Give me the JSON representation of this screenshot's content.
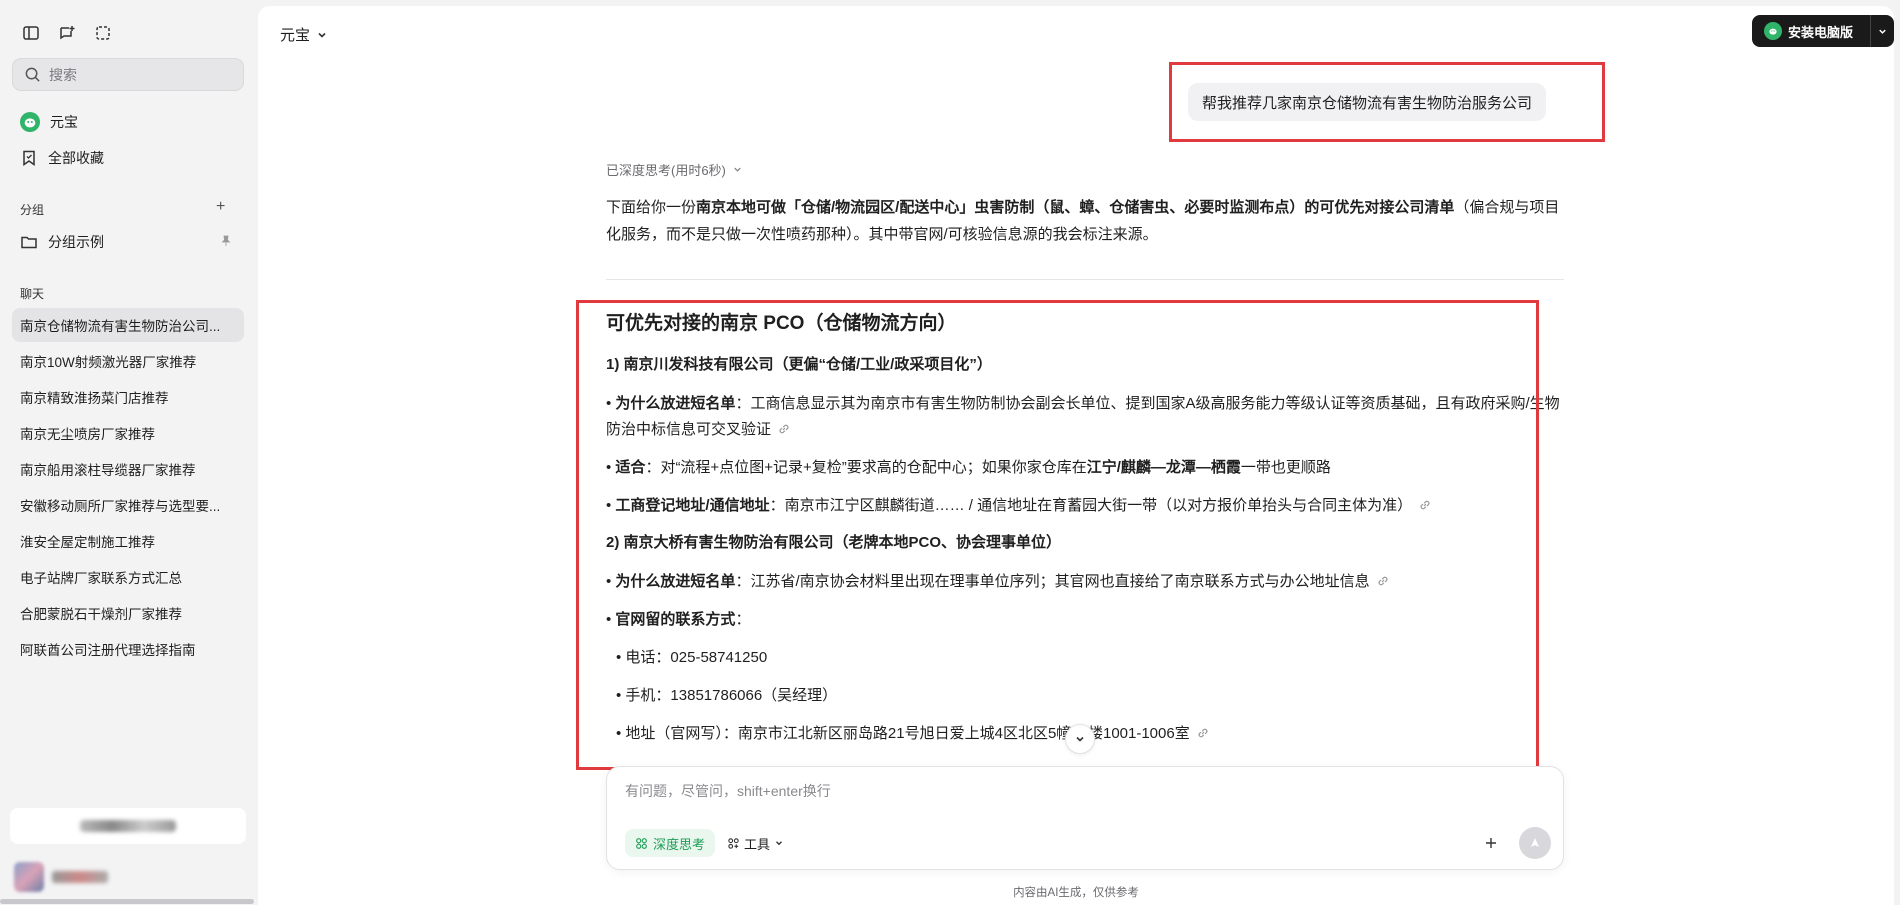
{
  "sidebar": {
    "search_placeholder": "搜索",
    "nav": [
      {
        "label": "元宝"
      },
      {
        "label": "全部收藏"
      }
    ],
    "groups_label": "分组",
    "group_example": "分组示例",
    "chats_label": "聊天",
    "chats": [
      "南京仓储物流有害生物防治公司...",
      "南京10W射频激光器厂家推荐",
      "南京精致淮扬菜门店推荐",
      "南京无尘喷房厂家推荐",
      "南京船用滚柱导缆器厂家推荐",
      "安徽移动厕所厂家推荐与选型要...",
      "淮安全屋定制施工推荐",
      "电子站牌厂家联系方式汇总",
      "合肥蒙脱石干燥剂厂家推荐",
      "阿联酋公司注册代理选择指南"
    ]
  },
  "header": {
    "model": "元宝",
    "install_label": "安装电脑版"
  },
  "conversation": {
    "user_message": "帮我推荐几家南京仓储物流有害生物防治服务公司",
    "deep_think_status": "已深度思考(用时6秒)",
    "intro": {
      "p1": "下面给你一份",
      "b1": "南京本地可做「仓储/物流园区/配送中心」虫害防制（鼠、蟑、仓储害虫、必要时监测布点）的可优先对接公司清单",
      "p2": "（偏合规与项目化服务，而不是只做一次性喷药那种）。其中带官网/可核验信息源的我会标注来源。"
    },
    "heading": "可优先对接的南京 PCO（仓储物流方向）",
    "company1": {
      "title": "1) 南京川发科技有限公司（更偏“仓储/工业/政采项目化”）",
      "why_label": "为什么放进短名单",
      "why_text": "：工商信息显示其为南京市有害生物防制协会副会长单位、提到国家A级高服务能力等级认证等资质基础，且有政府采购/生物防治中标信息可交叉验证",
      "fit_label": "适合",
      "fit_text1": "：对“流程+点位图+记录+复检”要求高的仓配中心；如果你家仓库在",
      "fit_bold": "江宁/麒麟—龙潭—栖霞",
      "fit_text2": "一带也更顺路",
      "addr_label": "工商登记地址/通信地址",
      "addr_text": "：南京市江宁区麒麟街道…… / 通信地址在育蓄园大街一带（以对方报价单抬头与合同主体为准）"
    },
    "company2": {
      "title": "2) 南京大桥有害生物防治有限公司（老牌本地PCO、协会理事单位）",
      "why_label": "为什么放进短名单",
      "why_text": "：江苏省/南京协会材料里出现在理事单位序列；其官网也直接给了南京联系方式与办公地址信息",
      "contact_label": "官网留的联系方式",
      "contact_colon": "：",
      "phone": "• 电话：025-58741250",
      "mobile": "• 手机：13851786066（吴经理）",
      "address": "• 地址（官网写）：南京市江北新区丽岛路21号旭日爱上城4区北区5幢10楼1001-1006室"
    }
  },
  "composer": {
    "placeholder": "有问题，尽管问，shift+enter换行",
    "deep_think_label": "深度思考",
    "tools_label": "工具"
  },
  "disclaimer": "内容由AI生成，仅供参考",
  "colors": {
    "accent_green": "#1f9d55",
    "highlight_red": "#e03a3e"
  }
}
